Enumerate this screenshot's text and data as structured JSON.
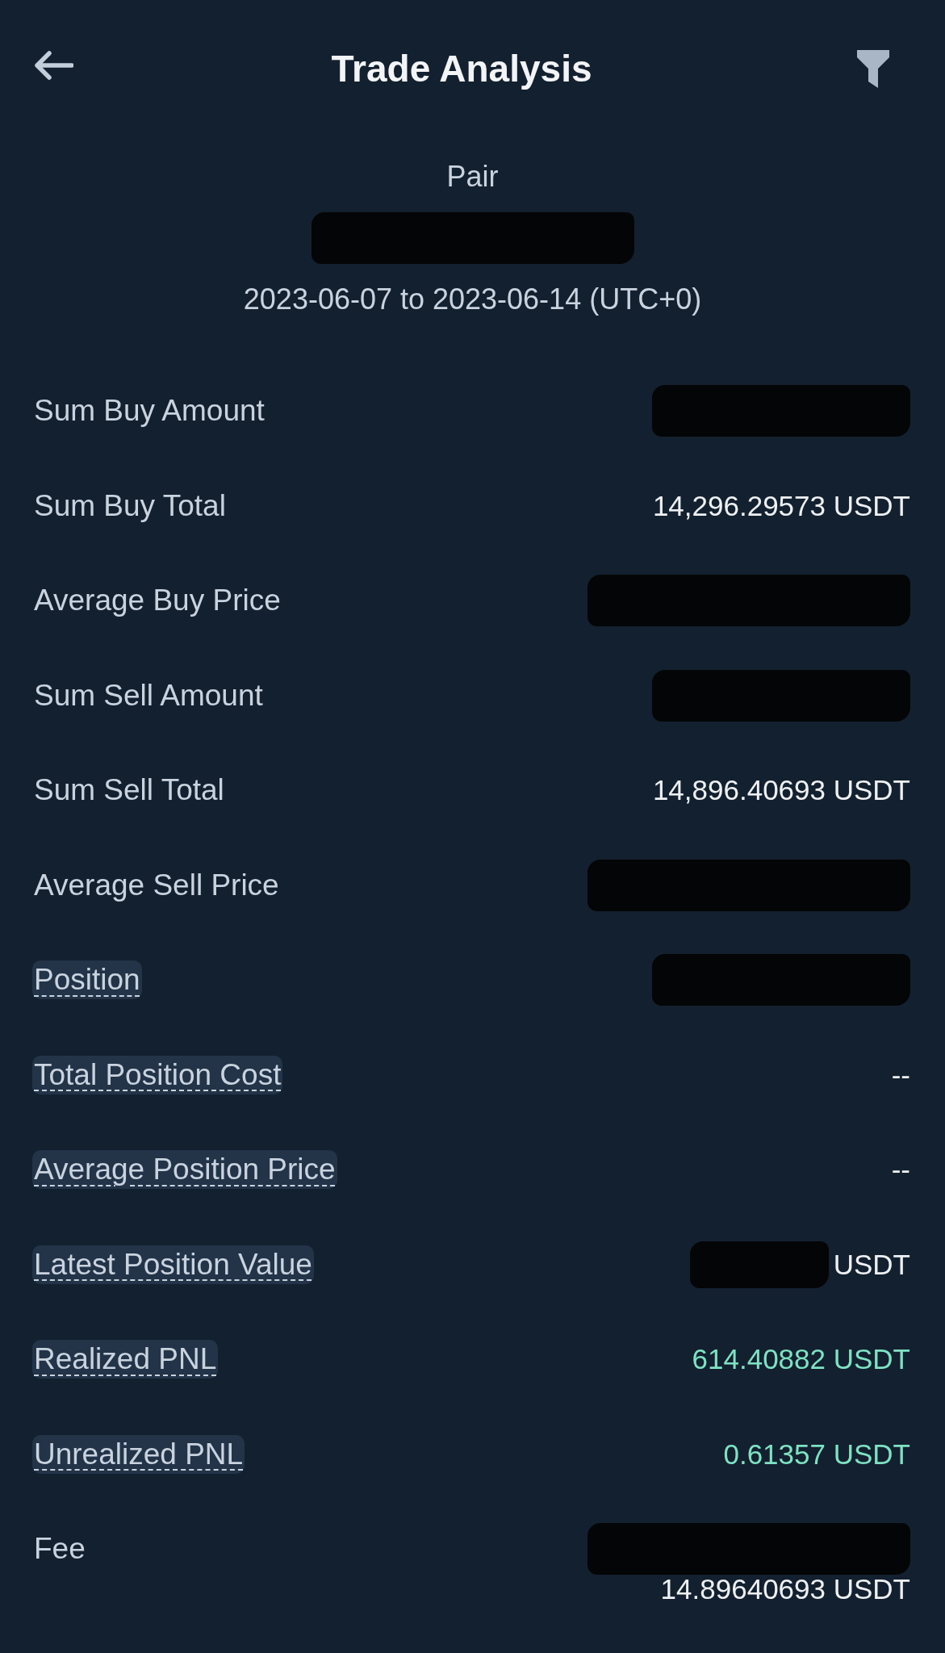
{
  "header": {
    "title": "Trade Analysis"
  },
  "summary": {
    "label": "Pair",
    "value": {
      "kind": "redacted",
      "wide": true
    },
    "period": "2023-06-07 to 2023-06-14 (UTC+0)"
  },
  "rows": [
    {
      "label": "Sum Buy Amount",
      "hint": false,
      "lines": [
        [
          {
            "kind": "redacted",
            "wide": false
          }
        ]
      ]
    },
    {
      "label": "Sum Buy Total",
      "hint": false,
      "lines": [
        [
          {
            "kind": "text",
            "text": "14,296.29573 USDT",
            "profit": false
          }
        ]
      ]
    },
    {
      "label": "Average Buy Price",
      "hint": false,
      "lines": [
        [
          {
            "kind": "redacted",
            "wide": true
          }
        ]
      ]
    },
    {
      "label": "Sum Sell Amount",
      "hint": false,
      "lines": [
        [
          {
            "kind": "redacted",
            "wide": false
          }
        ]
      ]
    },
    {
      "label": "Sum Sell Total",
      "hint": false,
      "lines": [
        [
          {
            "kind": "text",
            "text": "14,896.40693 USDT",
            "profit": false
          }
        ]
      ]
    },
    {
      "label": "Average Sell Price",
      "hint": false,
      "lines": [
        [
          {
            "kind": "redacted",
            "wide": true
          }
        ]
      ]
    },
    {
      "label": "Position",
      "hint": true,
      "lines": [
        [
          {
            "kind": "redacted",
            "wide": false
          }
        ]
      ]
    },
    {
      "label": "Total Position Cost",
      "hint": true,
      "lines": [
        [
          {
            "kind": "text",
            "text": "--",
            "profit": false
          }
        ]
      ]
    },
    {
      "label": "Average Position Price",
      "hint": true,
      "lines": [
        [
          {
            "kind": "text",
            "text": "--",
            "profit": false
          }
        ]
      ]
    },
    {
      "label": "Latest Position Value",
      "hint": true,
      "lines": [
        [
          {
            "kind": "redacted",
            "wide": false
          },
          {
            "kind": "text",
            "text": "USDT",
            "profit": false
          }
        ]
      ]
    },
    {
      "label": "Realized PNL",
      "hint": true,
      "lines": [
        [
          {
            "kind": "text",
            "text": "614.40882 USDT",
            "profit": true
          }
        ]
      ]
    },
    {
      "label": "Unrealized PNL",
      "hint": true,
      "lines": [
        [
          {
            "kind": "text",
            "text": "0.61357 USDT",
            "profit": true
          }
        ]
      ]
    },
    {
      "label": "Fee",
      "hint": false,
      "lines": [
        [
          {
            "kind": "redacted",
            "wide": true
          }
        ],
        [
          {
            "kind": "text",
            "text": "14.89640693 USDT",
            "profit": false
          }
        ]
      ]
    }
  ]
}
